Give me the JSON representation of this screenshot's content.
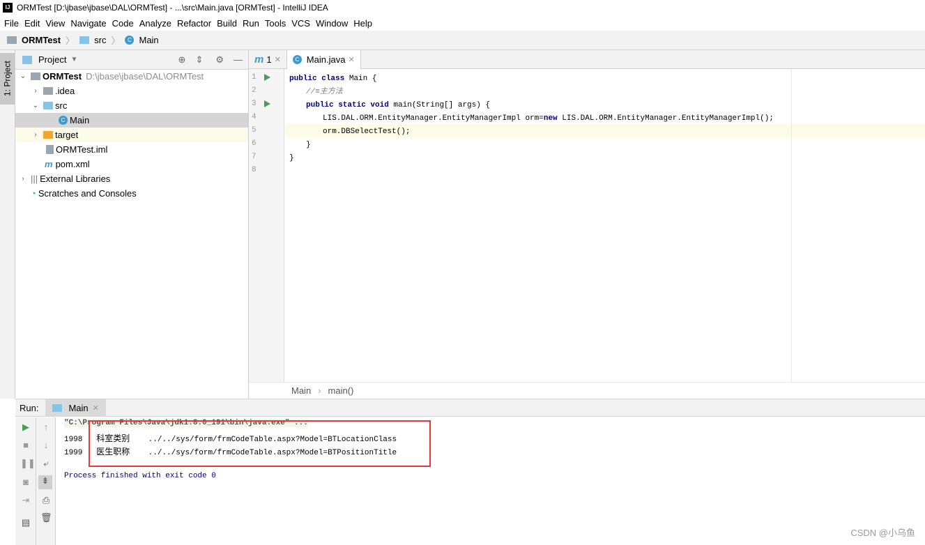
{
  "window": {
    "title": "ORMTest [D:\\jbase\\jbase\\DAL\\ORMTest] - ...\\src\\Main.java [ORMTest] - IntelliJ IDEA",
    "logo": "IJ"
  },
  "menu": [
    "File",
    "Edit",
    "View",
    "Navigate",
    "Code",
    "Analyze",
    "Refactor",
    "Build",
    "Run",
    "Tools",
    "VCS",
    "Window",
    "Help"
  ],
  "breadcrumb": [
    "ORMTest",
    "src",
    "Main"
  ],
  "side_stripe": {
    "tab": "1: Project"
  },
  "project": {
    "header": "Project",
    "tree": [
      {
        "label": "ORMTest",
        "path": "D:\\jbase\\jbase\\DAL\\ORMTest",
        "arrow": "expanded",
        "icon": "module-folder-icon"
      },
      {
        "label": ".idea",
        "arrow": "collapsed",
        "icon": "folder-icon"
      },
      {
        "label": "src",
        "arrow": "expanded",
        "icon": "source-folder-icon"
      },
      {
        "label": "Main",
        "icon": "java-class-icon",
        "selected": true
      },
      {
        "label": "target",
        "arrow": "collapsed",
        "icon": "excluded-folder-icon"
      },
      {
        "label": "ORMTest.iml",
        "icon": "iml-file-icon"
      },
      {
        "label": "pom.xml",
        "icon": "maven-icon"
      },
      {
        "label": "External Libraries",
        "arrow": "collapsed",
        "icon": "libraries-icon"
      },
      {
        "label": "Scratches and Consoles",
        "icon": "scratches-icon"
      }
    ]
  },
  "editor": {
    "tabs": [
      {
        "label": "1",
        "icon": "maven-m-icon"
      },
      {
        "label": "Main.java",
        "icon": "java-class-icon",
        "active": true
      }
    ],
    "lines": [
      "1",
      "2",
      "3",
      "4",
      "5",
      "6",
      "7",
      "8"
    ],
    "code": {
      "l1a": "public class",
      "l1b": " Main {",
      "l2": "//≡主方法",
      "l3a": "public static void",
      "l3b": " main(String[] args) {",
      "l4a": "LIS.DAL.ORM.EntityManager.EntityManagerImpl orm=",
      "l4b": "new",
      "l4c": " LIS.DAL.ORM.EntityManager.EntityManagerImpl();",
      "l5": "orm.DBSelectTest();",
      "l6": "}",
      "l7": "}"
    },
    "crumbs": [
      "Main",
      "main()"
    ]
  },
  "run": {
    "label": "Run:",
    "tab": "Main",
    "output": {
      "cmd": "\"C:\\Program Files\\Java\\jdk1.8.0_191\\bin\\java.exe\" ...",
      "rows": [
        {
          "id": "1998",
          "name": "科室类别",
          "url": "../../sys/form/frmCodeTable.aspx?Model=BTLocationClass"
        },
        {
          "id": "1999",
          "name": "医生职称",
          "url": "../../sys/form/frmCodeTable.aspx?Model=BTPositionTitle"
        }
      ],
      "finish": "Process finished with exit code 0"
    }
  },
  "watermark": "CSDN @小乌鱼"
}
